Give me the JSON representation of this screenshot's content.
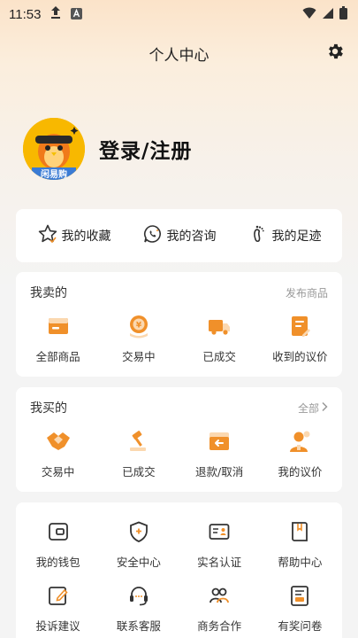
{
  "status": {
    "time": "11:53"
  },
  "header": {
    "title": "个人中心"
  },
  "profile": {
    "login_label": "登录/注册",
    "avatar_text": "闲易购"
  },
  "quick": [
    {
      "label": "我的收藏",
      "icon": "star-icon"
    },
    {
      "label": "我的咨询",
      "icon": "consult-icon"
    },
    {
      "label": "我的足迹",
      "icon": "footprint-icon"
    }
  ],
  "sell": {
    "title": "我卖的",
    "link": "发布商品",
    "items": [
      {
        "label": "全部商品",
        "icon": "all-goods-icon"
      },
      {
        "label": "交易中",
        "icon": "trading-icon"
      },
      {
        "label": "已成交",
        "icon": "delivered-icon"
      },
      {
        "label": "收到的议价",
        "icon": "received-offer-icon"
      }
    ]
  },
  "buy": {
    "title": "我买的",
    "link": "全部",
    "items": [
      {
        "label": "交易中",
        "icon": "handshake-icon"
      },
      {
        "label": "已成交",
        "icon": "gavel-icon"
      },
      {
        "label": "退款/取消",
        "icon": "refund-icon"
      },
      {
        "label": "我的议价",
        "icon": "my-offer-icon"
      }
    ]
  },
  "tools": [
    {
      "label": "我的钱包",
      "icon": "wallet-icon"
    },
    {
      "label": "安全中心",
      "icon": "shield-icon"
    },
    {
      "label": "实名认证",
      "icon": "id-card-icon"
    },
    {
      "label": "帮助中心",
      "icon": "help-book-icon"
    },
    {
      "label": "投诉建议",
      "icon": "feedback-icon"
    },
    {
      "label": "联系客服",
      "icon": "headset-icon"
    },
    {
      "label": "商务合作",
      "icon": "cooperation-icon"
    },
    {
      "label": "有奖问卷",
      "icon": "survey-icon"
    }
  ],
  "colors": {
    "accent": "#f0902a",
    "accent_light": "#fbd8b0",
    "background": "#f4f4f4"
  }
}
